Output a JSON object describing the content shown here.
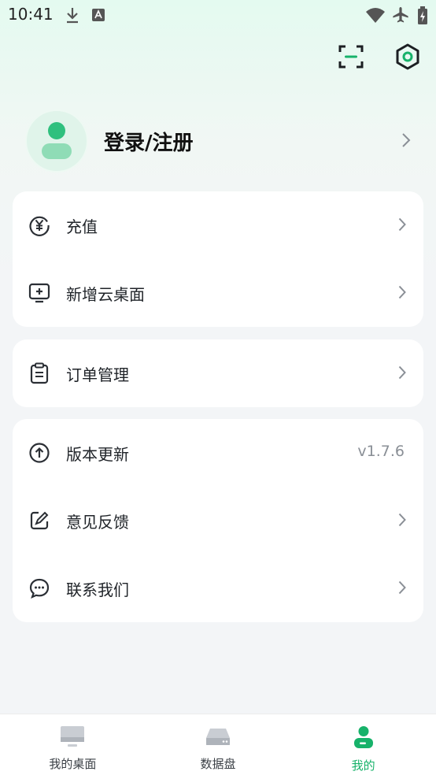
{
  "status_bar": {
    "time": "10:41"
  },
  "profile": {
    "login_label": "登录/注册"
  },
  "menu_group_1": [
    {
      "label": "充值",
      "icon": "yuan-icon"
    },
    {
      "label": "新增云桌面",
      "icon": "add-desktop-icon"
    }
  ],
  "menu_group_2": [
    {
      "label": "订单管理",
      "icon": "clipboard-icon"
    }
  ],
  "menu_group_3": [
    {
      "label": "版本更新",
      "icon": "upload-icon",
      "value": "v1.7.6"
    },
    {
      "label": "意见反馈",
      "icon": "edit-icon"
    },
    {
      "label": "联系我们",
      "icon": "chat-icon"
    }
  ],
  "tab_bar": {
    "tabs": [
      {
        "label": "我的桌面",
        "active": false
      },
      {
        "label": "数据盘",
        "active": false
      },
      {
        "label": "我的",
        "active": true
      }
    ]
  },
  "colors": {
    "accent": "#17b26a",
    "background": "#f3f5f7",
    "card": "#ffffff"
  }
}
